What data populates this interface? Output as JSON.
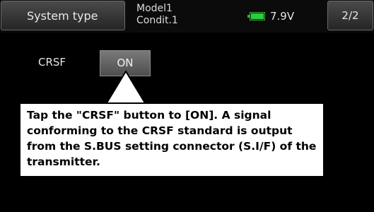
{
  "header": {
    "title": "System type",
    "model_name": "Model1",
    "condition": "Condit.1",
    "battery_voltage": "7.9V",
    "battery_icon": "battery-icon",
    "page_indicator": "2/2"
  },
  "settings": {
    "crsf_label": "CRSF",
    "crsf_button": "ON"
  },
  "callout": {
    "text": "Tap the \"CRSF\" button to [ON]. A signal conforming to the CRSF standard is output from the S.BUS setting connector (S.I/F) of the transmitter."
  },
  "colors": {
    "battery_fill": "#2ecc40",
    "background": "#000000"
  }
}
